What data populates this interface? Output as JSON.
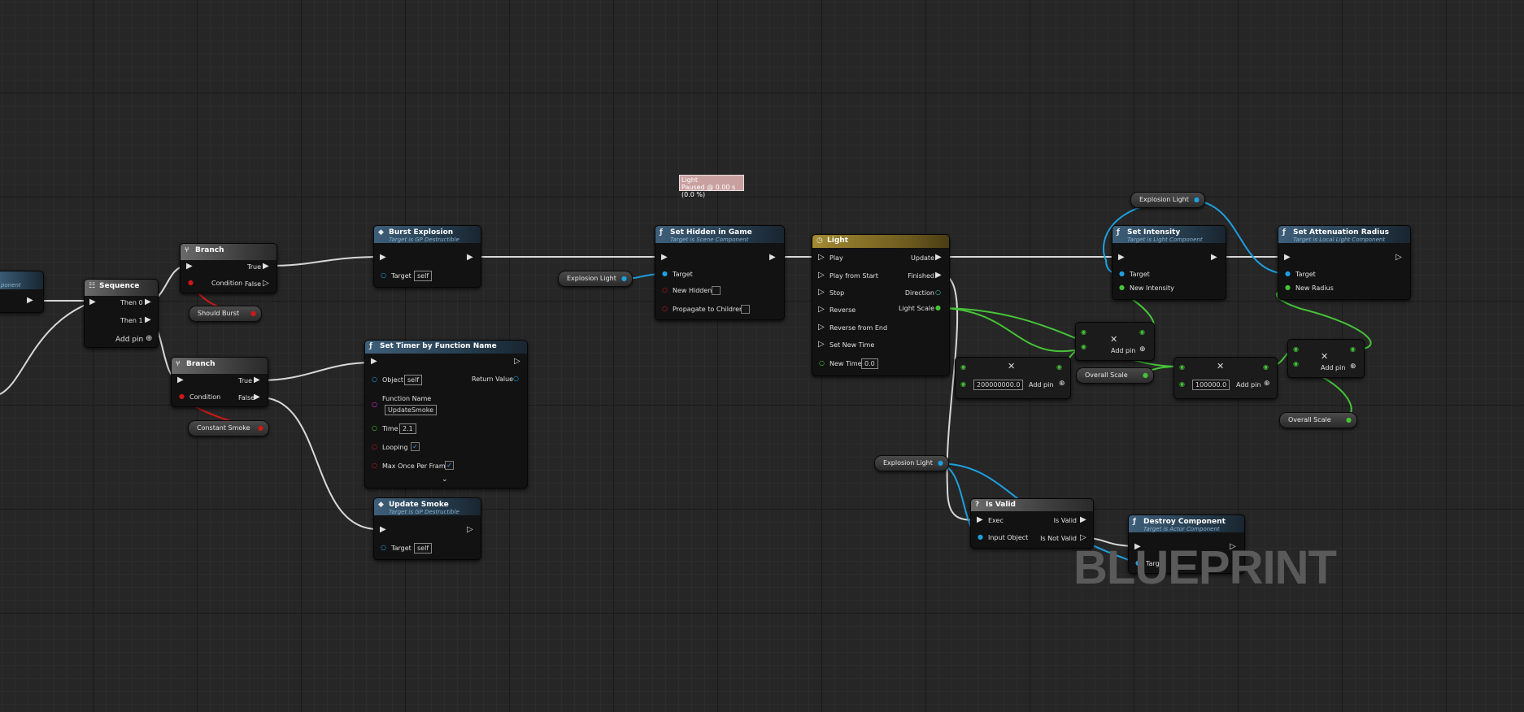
{
  "watermark": "BLUEPRINT",
  "colors": {
    "exec": "#ffffff",
    "object": "#1ea0e0",
    "bool": "#d01818",
    "float": "#46c438",
    "string": "#e030d0"
  },
  "left_partial": {
    "label": "ponent"
  },
  "sequence": {
    "title": "Sequence",
    "then0": "Then 0",
    "then1": "Then 1",
    "add_pin": "Add pin"
  },
  "branch1": {
    "title": "Branch",
    "true_label": "True",
    "false_label": "False",
    "condition": "Condition"
  },
  "branch2": {
    "title": "Branch",
    "true_label": "True",
    "false_label": "False",
    "condition": "Condition"
  },
  "var_should_burst": "Should Burst",
  "var_constant_smoke": "Constant Smoke",
  "burst_explosion": {
    "title": "Burst Explosion",
    "subtitle": "Target is GP Destructible",
    "target": "Target",
    "target_value": "self"
  },
  "set_timer": {
    "title": "Set Timer by Function Name",
    "object": "Object",
    "object_value": "self",
    "return_value": "Return Value",
    "function_name": "Function Name",
    "function_value": "UpdateSmoke",
    "time": "Time",
    "time_value": "2.1",
    "looping": "Looping",
    "max_once": "Max Once Per Frame"
  },
  "update_smoke": {
    "title": "Update Smoke",
    "subtitle": "Target is GP Destructible",
    "target": "Target",
    "target_value": "self"
  },
  "var_explosion_light_1": "Explosion Light",
  "set_hidden": {
    "title": "Set Hidden in Game",
    "subtitle": "Target is Scene Component",
    "target": "Target",
    "new_hidden": "New Hidden",
    "propagate": "Propagate to Children"
  },
  "tooltip": {
    "line1": "Light",
    "line2": "Paused @ 0.00 s (0.0 %)"
  },
  "light": {
    "title": "Light",
    "play": "Play",
    "play_from_start": "Play from Start",
    "stop": "Stop",
    "reverse": "Reverse",
    "reverse_from_end": "Reverse from End",
    "set_new_time": "Set New Time",
    "new_time": "New Time",
    "new_time_value": "0.0",
    "update": "Update",
    "finished": "Finished",
    "direction": "Direction",
    "light_scale": "Light Scale"
  },
  "multiply1": {
    "value": "200000000.0",
    "add_pin": "Add pin"
  },
  "multiply2": {
    "add_pin": "Add pin"
  },
  "var_overall_scale_1": "Overall Scale",
  "multiply3": {
    "value": "100000.0",
    "add_pin": "Add pin"
  },
  "multiply4": {
    "add_pin": "Add pin"
  },
  "var_overall_scale_2": "Overall Scale",
  "var_explosion_light_2": "Explosion Light",
  "set_intensity": {
    "title": "Set Intensity",
    "subtitle": "Target is Light Component",
    "target": "Target",
    "new_intensity": "New Intensity"
  },
  "set_atten": {
    "title": "Set Attenuation Radius",
    "subtitle": "Target is Local Light Component",
    "target": "Target",
    "new_radius": "New Radius"
  },
  "var_explosion_light_3": "Explosion Light",
  "is_valid": {
    "title": "Is Valid",
    "exec": "Exec",
    "input_object": "Input Object",
    "is_valid": "Is Valid",
    "is_not_valid": "Is Not Valid"
  },
  "destroy": {
    "title": "Destroy Component",
    "subtitle": "Target is Actor Component",
    "target": "Target"
  }
}
